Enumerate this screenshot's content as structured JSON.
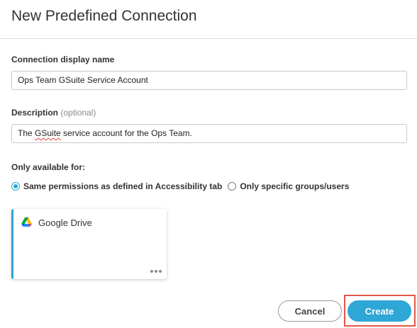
{
  "dialog": {
    "title": "New Predefined Connection"
  },
  "form": {
    "display_name": {
      "label": "Connection display name",
      "value": "Ops Team GSuite Service Account"
    },
    "description": {
      "label": "Description",
      "optional_note": "(optional)",
      "value_prefix": "The ",
      "value_misspelled": "GSuite",
      "value_suffix": " service account for the Ops Team."
    },
    "availability": {
      "label": "Only available for:",
      "options": [
        {
          "label": "Same permissions as defined in Accessibility tab",
          "selected": true
        },
        {
          "label": "Only specific groups/users",
          "selected": false
        }
      ]
    }
  },
  "connection_card": {
    "icon": "google-drive-icon",
    "name": "Google Drive",
    "accent_color": "#2ea6d6"
  },
  "actions": {
    "cancel_label": "Cancel",
    "create_label": "Create",
    "highlight_color": "#e4574a"
  }
}
